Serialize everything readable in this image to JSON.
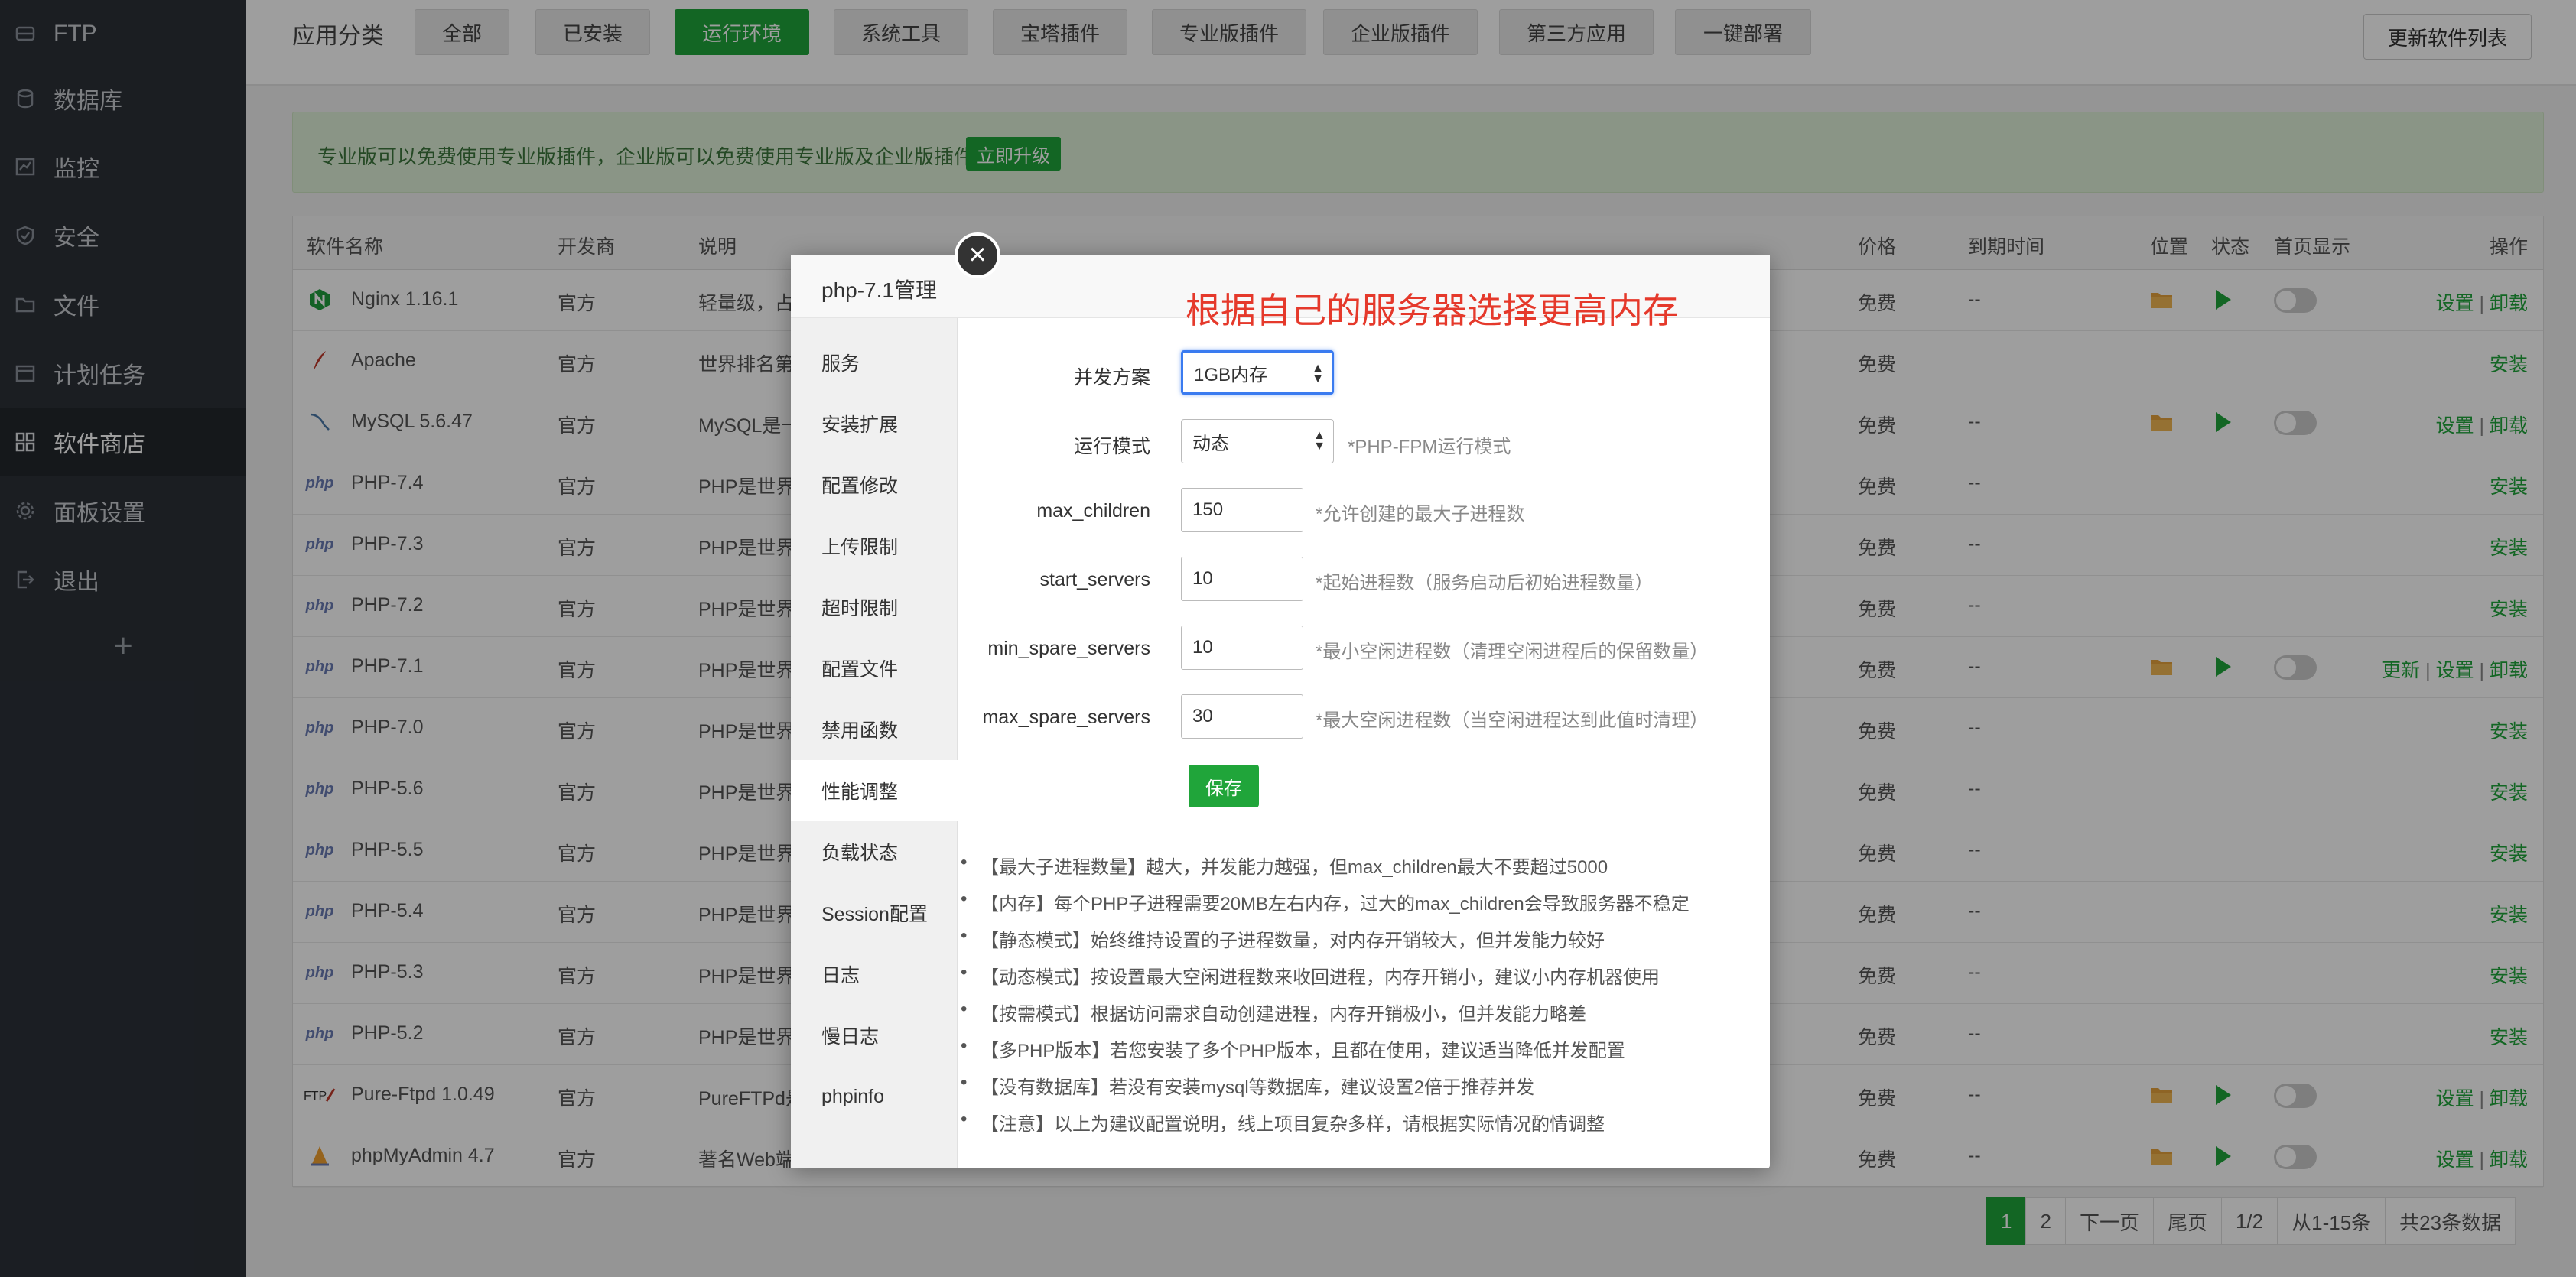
{
  "sidebar": {
    "items": [
      {
        "label": "FTP",
        "icon": "ftp-icon"
      },
      {
        "label": "数据库",
        "icon": "database-icon"
      },
      {
        "label": "监控",
        "icon": "monitor-icon"
      },
      {
        "label": "安全",
        "icon": "shield-icon"
      },
      {
        "label": "文件",
        "icon": "folder-icon"
      },
      {
        "label": "计划任务",
        "icon": "calendar-icon"
      },
      {
        "label": "软件商店",
        "icon": "grid-icon"
      },
      {
        "label": "面板设置",
        "icon": "gear-icon"
      },
      {
        "label": "退出",
        "icon": "logout-icon"
      }
    ],
    "add_label": "+"
  },
  "topbar": {
    "label": "应用分类",
    "categories": [
      "全部",
      "已安装",
      "运行环境",
      "系统工具",
      "宝塔插件",
      "专业版插件",
      "企业版插件",
      "第三方应用",
      "一键部署"
    ],
    "refresh_label": "更新软件列表"
  },
  "notice": {
    "text": "专业版可以免费使用专业版插件，企业版可以免费使用专业版及企业版插件 。",
    "upgrade_label": "立即升级"
  },
  "table": {
    "headers": [
      "软件名称",
      "开发商",
      "说明",
      "价格",
      "到期时间",
      "位置",
      "状态",
      "首页显示",
      "操作"
    ],
    "rows": [
      {
        "name": "Nginx 1.16.1",
        "vendor": "官方",
        "desc": "轻量级，占",
        "price": "免费",
        "expire": "--",
        "op": [
          "设置",
          "卸载"
        ],
        "installed": true
      },
      {
        "name": "Apache",
        "vendor": "官方",
        "desc": "世界排名第",
        "price": "免费",
        "expire": "",
        "op": [
          "安装"
        ],
        "installed": false
      },
      {
        "name": "MySQL 5.6.47",
        "vendor": "官方",
        "desc": "MySQL是一",
        "price": "免费",
        "expire": "--",
        "op": [
          "设置",
          "卸载"
        ],
        "installed": true
      },
      {
        "name": "PHP-7.4",
        "vendor": "官方",
        "desc": "PHP是世界",
        "price": "免费",
        "expire": "--",
        "op": [
          "安装"
        ],
        "installed": false
      },
      {
        "name": "PHP-7.3",
        "vendor": "官方",
        "desc": "PHP是世界",
        "price": "免费",
        "expire": "--",
        "op": [
          "安装"
        ],
        "installed": false
      },
      {
        "name": "PHP-7.2",
        "vendor": "官方",
        "desc": "PHP是世界",
        "price": "免费",
        "expire": "--",
        "op": [
          "安装"
        ],
        "installed": false
      },
      {
        "name": "PHP-7.1",
        "vendor": "官方",
        "desc": "PHP是世界",
        "price": "免费",
        "expire": "--",
        "op": [
          "更新",
          "设置",
          "卸载"
        ],
        "installed": true
      },
      {
        "name": "PHP-7.0",
        "vendor": "官方",
        "desc": "PHP是世界",
        "price": "免费",
        "expire": "--",
        "op": [
          "安装"
        ],
        "installed": false
      },
      {
        "name": "PHP-5.6",
        "vendor": "官方",
        "desc": "PHP是世界",
        "price": "免费",
        "expire": "--",
        "op": [
          "安装"
        ],
        "installed": false
      },
      {
        "name": "PHP-5.5",
        "vendor": "官方",
        "desc": "PHP是世界",
        "price": "免费",
        "expire": "--",
        "op": [
          "安装"
        ],
        "installed": false
      },
      {
        "name": "PHP-5.4",
        "vendor": "官方",
        "desc": "PHP是世界",
        "price": "免费",
        "expire": "--",
        "op": [
          "安装"
        ],
        "installed": false
      },
      {
        "name": "PHP-5.3",
        "vendor": "官方",
        "desc": "PHP是世界",
        "price": "免费",
        "expire": "--",
        "op": [
          "安装"
        ],
        "installed": false
      },
      {
        "name": "PHP-5.2",
        "vendor": "官方",
        "desc": "PHP是世界",
        "price": "免费",
        "expire": "--",
        "op": [
          "安装"
        ],
        "installed": false
      },
      {
        "name": "Pure-Ftpd 1.0.49",
        "vendor": "官方",
        "desc": "PureFTPd是",
        "price": "免费",
        "expire": "--",
        "op": [
          "设置",
          "卸载"
        ],
        "installed": true
      },
      {
        "name": "phpMyAdmin 4.7",
        "vendor": "官方",
        "desc": "著名Web端",
        "price": "免费",
        "expire": "--",
        "op": [
          "设置",
          "卸载"
        ],
        "installed": true
      }
    ]
  },
  "pager": {
    "items": [
      "1",
      "2",
      "下一页",
      "尾页",
      "1/2",
      "从1-15条",
      "共23条数据"
    ]
  },
  "modal": {
    "title": "php-7.1管理",
    "hint": "根据自己的服务器选择更高内存",
    "close_label": "×",
    "nav": [
      "服务",
      "安装扩展",
      "配置修改",
      "上传限制",
      "超时限制",
      "配置文件",
      "禁用函数",
      "性能调整",
      "负载状态",
      "Session配置",
      "日志",
      "慢日志",
      "phpinfo"
    ],
    "form": {
      "concurrency_label": "并发方案",
      "concurrency_value": "1GB内存",
      "mode_label": "运行模式",
      "mode_value": "动态",
      "mode_note": "*PHP-FPM运行模式",
      "max_children_label": "max_children",
      "max_children_value": "150",
      "max_children_note": "*允许创建的最大子进程数",
      "start_servers_label": "start_servers",
      "start_servers_value": "10",
      "start_servers_note": "*起始进程数（服务启动后初始进程数量）",
      "min_spare_label": "min_spare_servers",
      "min_spare_value": "10",
      "min_spare_note": "*最小空闲进程数（清理空闲进程后的保留数量）",
      "max_spare_label": "max_spare_servers",
      "max_spare_value": "30",
      "max_spare_note": "*最大空闲进程数（当空闲进程达到此值时清理）",
      "save_label": "保存"
    },
    "tips": [
      "【最大子进程数量】越大，并发能力越强，但max_children最大不要超过5000",
      "【内存】每个PHP子进程需要20MB左右内存，过大的max_children会导致服务器不稳定",
      "【静态模式】始终维持设置的子进程数量，对内存开销较大，但并发能力较好",
      "【动态模式】按设置最大空闲进程数来收回进程，内存开销小，建议小内存机器使用",
      "【按需模式】根据访问需求自动创建进程，内存开销极小，但并发能力略差",
      "【多PHP版本】若您安装了多个PHP版本，且都在使用，建议适当降低并发配置",
      "【没有数据库】若没有安装mysql等数据库，建议设置2倍于推荐并发",
      "【注意】以上为建议配置说明，线上项目复杂多样，请根据实际情况酌情调整"
    ]
  }
}
